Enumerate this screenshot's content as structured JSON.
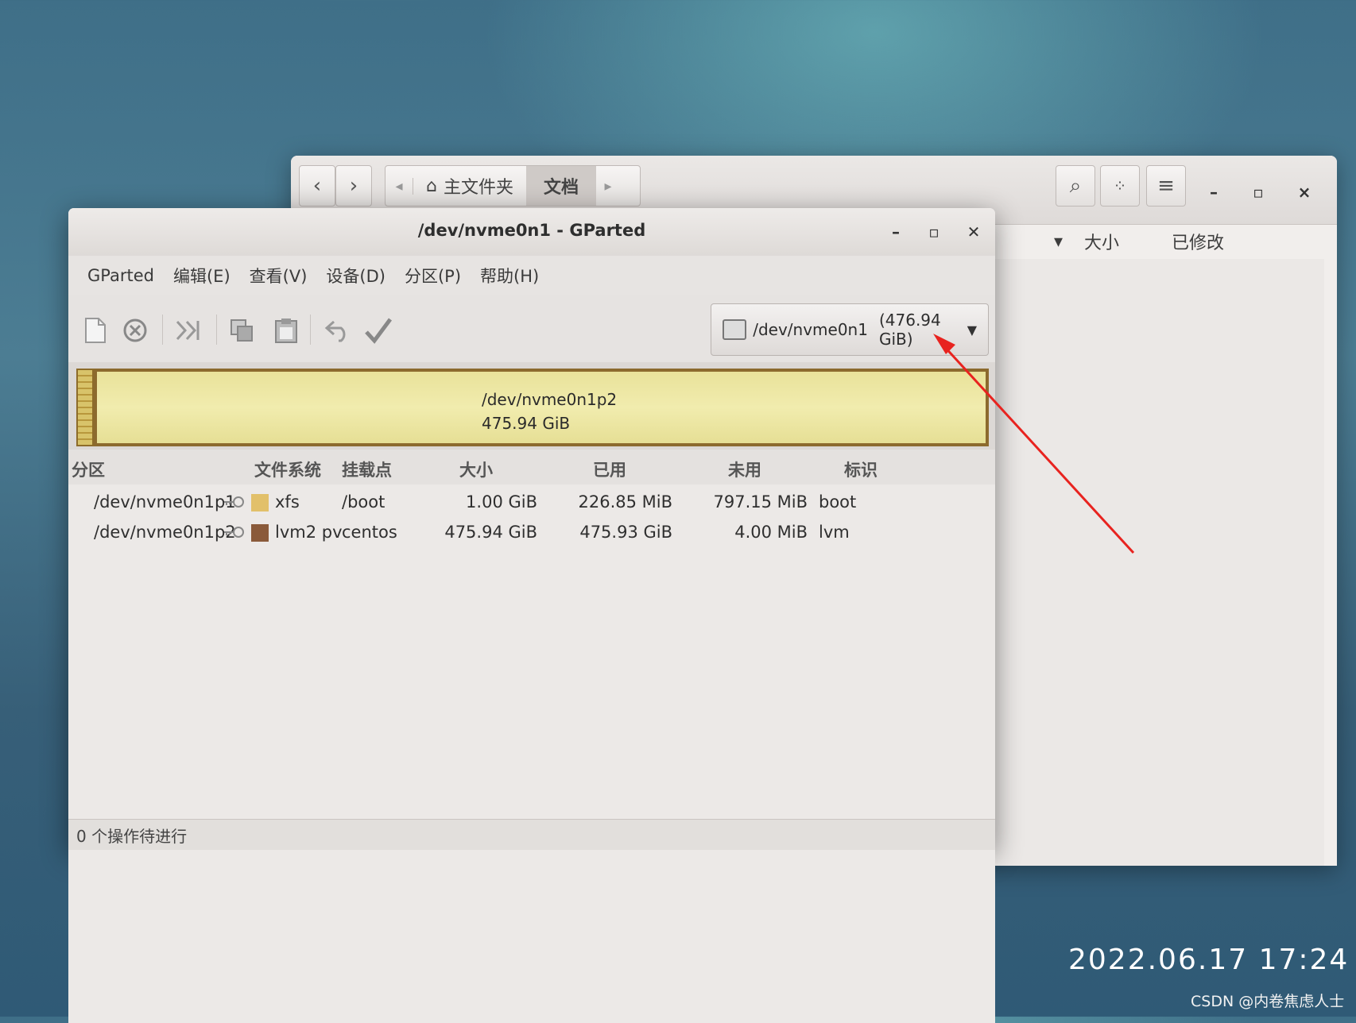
{
  "file_manager": {
    "back_icon": "chevron-left-icon",
    "forward_icon": "chevron-right-icon",
    "home_label": "主文件夹",
    "current_folder": "文档",
    "columns": {
      "size": "大小",
      "modified": "已修改"
    }
  },
  "gparted": {
    "title": "/dev/nvme0n1 - GParted",
    "menu": [
      "GParted",
      "编辑(E)",
      "查看(V)",
      "设备(D)",
      "分区(P)",
      "帮助(H)"
    ],
    "device_selector": {
      "device": "/dev/nvme0n1",
      "size": "(476.94 GiB)"
    },
    "visual": {
      "partition": "/dev/nvme0n1p2",
      "size": "475.94 GiB"
    },
    "columns": [
      "分区",
      "文件系统",
      "挂载点",
      "大小",
      "已用",
      "未用",
      "标识"
    ],
    "partitions": [
      {
        "name": "/dev/nvme0n1p1",
        "fs": "xfs",
        "fs_color": "#e2c06a",
        "mount": "/boot",
        "size": "1.00 GiB",
        "used": "226.85 MiB",
        "unused": "797.15 MiB",
        "flags": "boot"
      },
      {
        "name": "/dev/nvme0n1p2",
        "fs": "lvm2 pv",
        "fs_color": "#8a5a3a",
        "mount": "centos",
        "size": "475.94 GiB",
        "used": "475.93 GiB",
        "unused": "4.00 MiB",
        "flags": "lvm"
      }
    ],
    "status": "0 个操作待进行"
  },
  "overlay": {
    "timestamp": "2022.06.17  17:24",
    "watermark": "CSDN @内卷焦虑人士",
    "annotation_color": "#e8231f"
  }
}
